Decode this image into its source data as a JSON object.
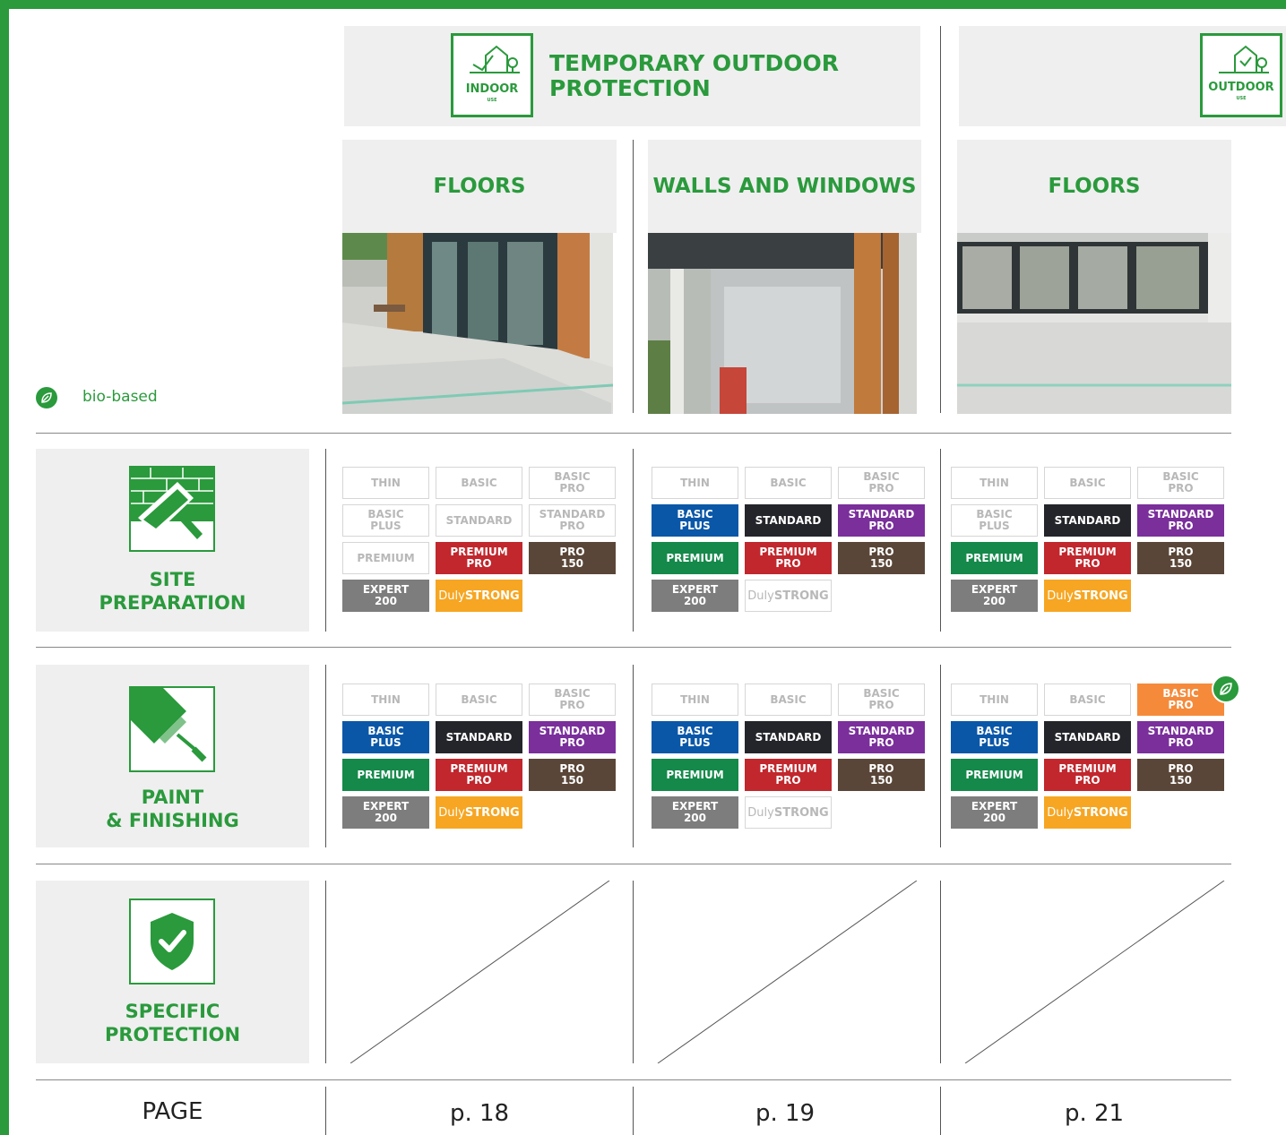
{
  "header": {
    "indoor_badge": {
      "label": "INDOOR",
      "sub": "USE"
    },
    "outdoor_badge": {
      "label": "OUTDOOR",
      "sub": "USE"
    },
    "title": "TEMPORARY OUTDOOR\nPROTECTION"
  },
  "columns": [
    {
      "title": "FLOORS",
      "page": "p. 18"
    },
    {
      "title": "WALLS AND WINDOWS",
      "page": "p. 19"
    },
    {
      "title": "FLOORS",
      "page": "p. 21"
    }
  ],
  "legend": {
    "bio_label": "bio-based",
    "icon": "leaf-icon"
  },
  "categories": [
    {
      "label": "SITE\nPREPARATION",
      "icon": "trowel-brick-icon"
    },
    {
      "label": "PAINT\n& FINISHING",
      "icon": "paint-roller-icon"
    },
    {
      "label": "SPECIFIC\nPROTECTION",
      "icon": "shield-check-icon"
    }
  ],
  "chips": {
    "thin": "THIN",
    "basic": "BASIC",
    "basic_pro": "BASIC\nPRO",
    "basic_plus": "BASIC\nPLUS",
    "standard": "STANDARD",
    "standard_pro": "STANDARD\nPRO",
    "premium": "PREMIUM",
    "premium_pro": "PREMIUM\nPRO",
    "pro_150": "PRO\n150",
    "expert_200": "EXPERT\n200",
    "duly_pre": "Duly",
    "duly_strong": "STRONG"
  },
  "chip_colors": {
    "basic_plus": "#0a57a8",
    "standard": "#24252a",
    "standard_pro": "#7a2f9b",
    "premium": "#14894a",
    "premium_pro": "#c1272d",
    "pro_150": "#5a4638",
    "expert_200": "#7d7d7d",
    "dulystrong": "#f6a623",
    "basic_pro_bio": "#f58a3a"
  },
  "page_label": "PAGE"
}
